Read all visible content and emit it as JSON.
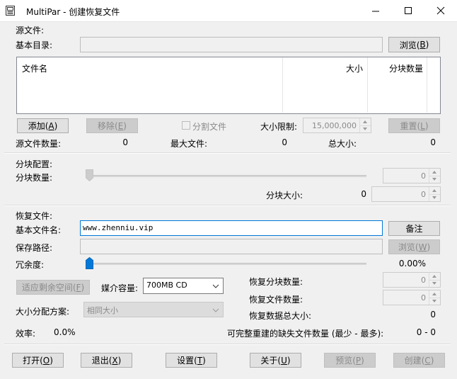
{
  "window": {
    "title": "MultiPar - 创建恢复文件"
  },
  "source": {
    "section_label": "源文件:",
    "base_dir_label": "基本目录:",
    "base_dir_value": "",
    "browse_button": "浏览(B)",
    "browse_button_main": "浏览(",
    "browse_button_key": "B",
    "list_headers": [
      "文件名",
      "大小",
      "分块数量"
    ],
    "add_button_main": "添加(",
    "add_button_key": "A",
    "remove_button_main": "移除(",
    "remove_button_key": "E",
    "split_checkbox_label": "分割文件",
    "size_limit_label": "大小限制:",
    "size_limit_value": "15,000,000",
    "reset_button_main": "重置(",
    "reset_button_key": "L",
    "file_count_label": "源文件数量:",
    "file_count_value": "0",
    "max_file_label": "最大文件:",
    "max_file_value": "0",
    "total_size_label": "总大小:",
    "total_size_value": "0"
  },
  "blocks": {
    "section_label": "分块配置:",
    "count_label": "分块数量:",
    "count_value": "0",
    "block_size_label": "分块大小:",
    "block_size_value": "0",
    "block_size_spin": "0"
  },
  "recovery": {
    "section_label": "恢复文件:",
    "base_name_label": "基本文件名:",
    "base_name_value": "www.zhenniu.vip",
    "comment_button": "备注",
    "save_path_label": "保存路径:",
    "save_path_value": "",
    "browse_button_main": "浏览(",
    "browse_button_key": "W",
    "redundancy_label": "冗余度:",
    "redundancy_value": "0.00%",
    "fit_space_button_main": "适应剩余空间(",
    "fit_space_button_key": "F",
    "media_label": "媒介容量:",
    "media_value": "700MB CD",
    "size_dist_label": "大小分配方案:",
    "size_dist_value": "相同大小",
    "recovery_blocks_label": "恢复分块数量:",
    "recovery_blocks_value": "0",
    "recovery_files_label": "恢复文件数量:",
    "recovery_files_value": "0",
    "recovery_total_label": "恢复数据总大小:",
    "recovery_total_value": "0",
    "efficiency_label": "效率:",
    "efficiency_value": "0.0%",
    "missing_label": "可完整重建的缺失文件数量 (最少 - 最多):",
    "missing_value": "0 - 0"
  },
  "footer": {
    "open_main": "打开(",
    "open_key": "O",
    "exit_main": "退出(",
    "exit_key": "X",
    "settings_main": "设置(",
    "settings_key": "T",
    "about_main": "关于(",
    "about_key": "U",
    "preview_main": "预览(",
    "preview_key": "P",
    "create_main": "创建(",
    "create_key": "C"
  },
  "icons": {
    "app": "multipar-app-icon",
    "minimize": "minimize-icon",
    "maximize": "maximize-icon",
    "close": "close-icon"
  },
  "colors": {
    "accent": "#0078d7",
    "window_bg": "#f0f0f0"
  }
}
